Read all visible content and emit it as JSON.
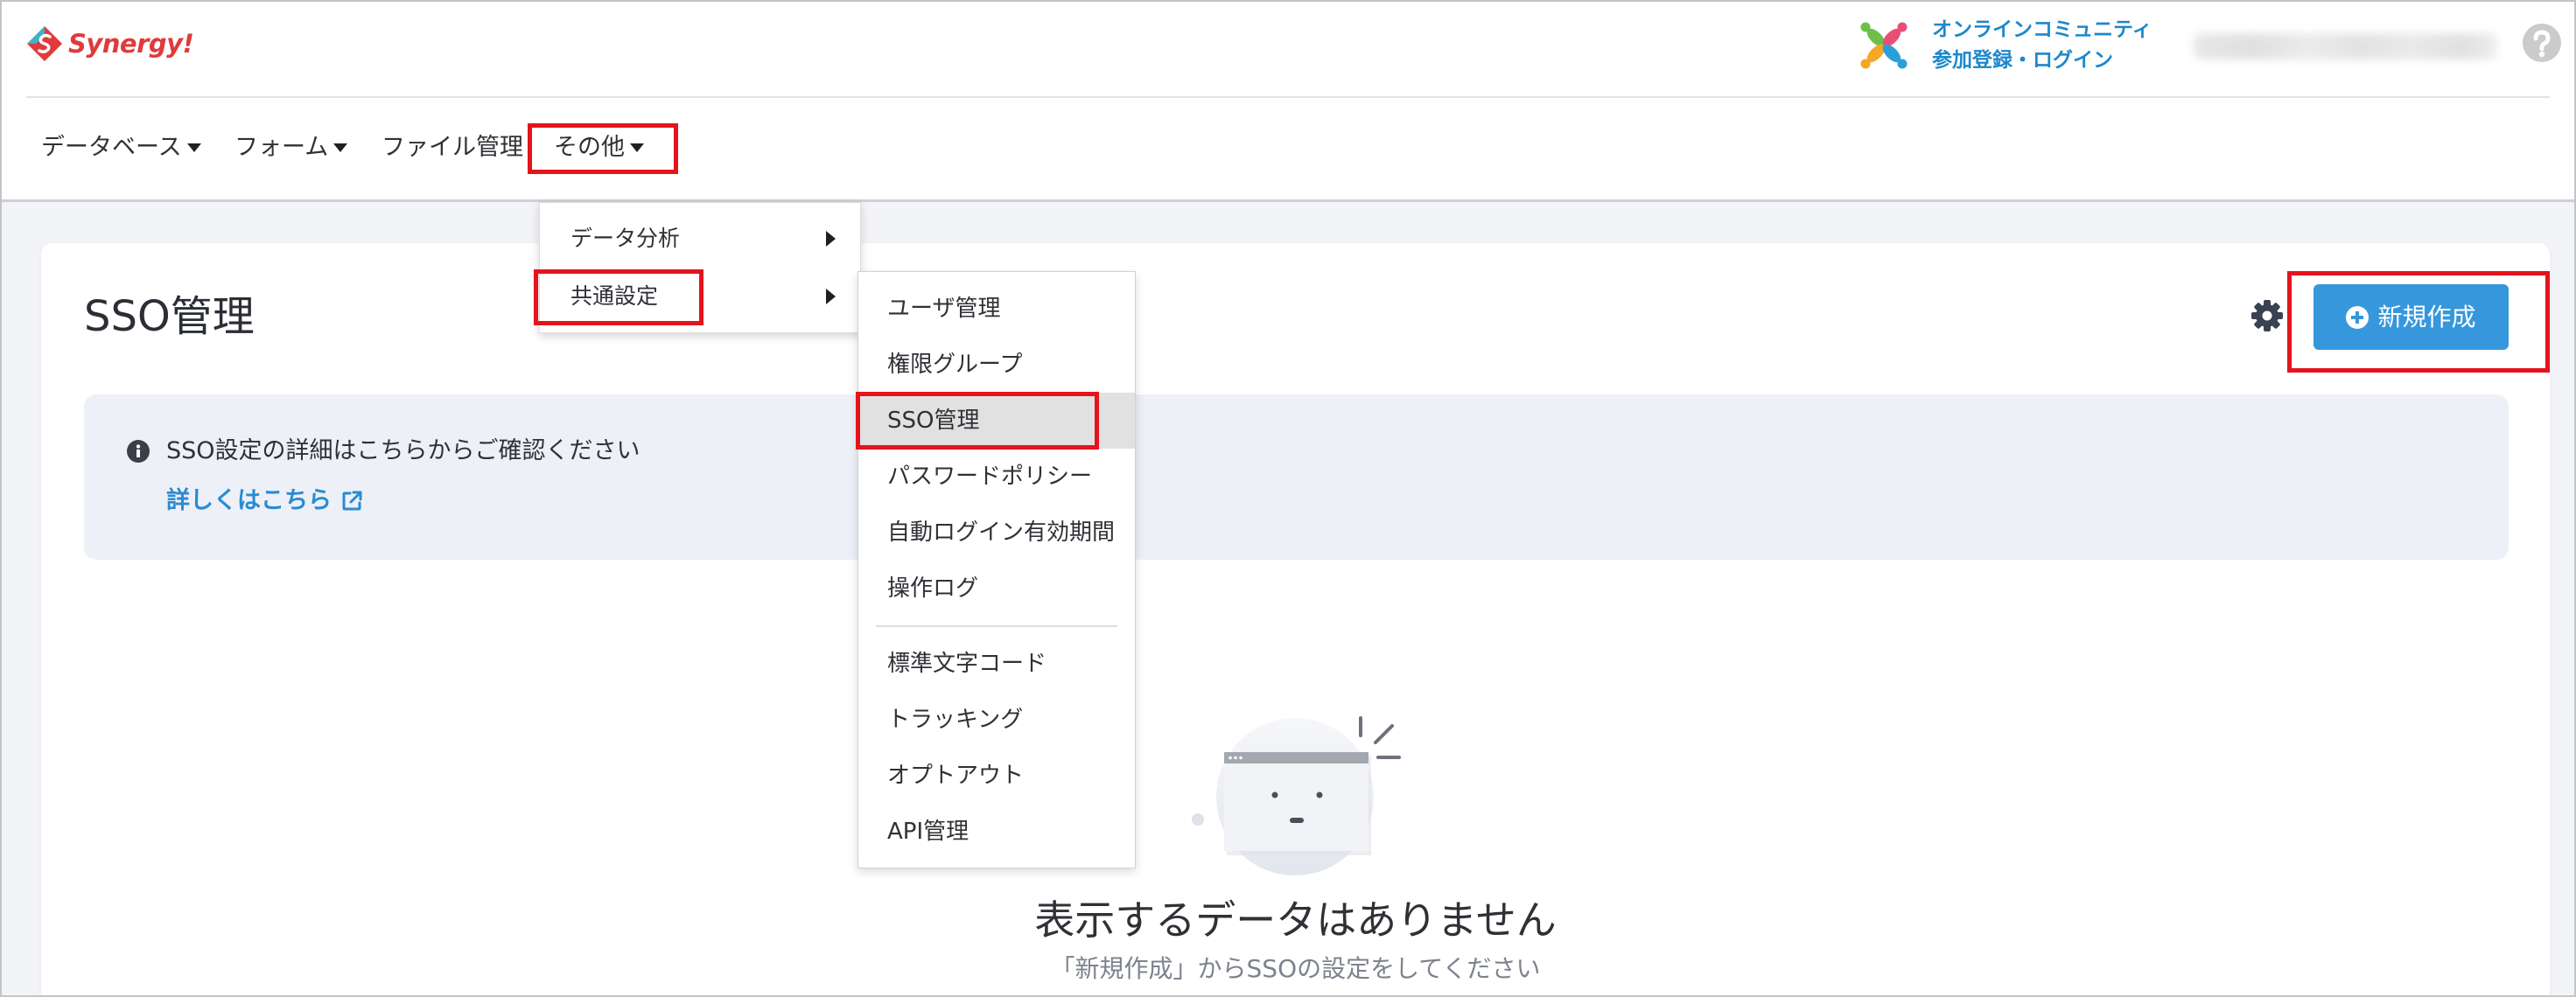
{
  "header": {
    "logo_text": "Synergy!",
    "logo_icon": "synergy-logo-icon",
    "community": {
      "icon": "community-pinwheel-icon",
      "title": "オンラインコミュニティ",
      "action": "参加登録・ログイン"
    },
    "help_icon": "help-icon"
  },
  "nav": {
    "items": [
      {
        "label": "データベース",
        "icon": "caret-down-icon"
      },
      {
        "label": "フォーム",
        "icon": "caret-down-icon"
      },
      {
        "label": "ファイル管理"
      },
      {
        "label": "その他",
        "icon": "caret-down-icon"
      }
    ]
  },
  "dropdown": {
    "items": [
      {
        "label": "データ分析",
        "icon": "caret-right-icon"
      },
      {
        "label": "共通設定",
        "icon": "caret-right-icon"
      }
    ]
  },
  "submenu": {
    "groups": [
      {
        "items": [
          {
            "label": "ユーザ管理"
          },
          {
            "label": "権限グループ"
          },
          {
            "label": "SSO管理",
            "selected": true
          },
          {
            "label": "パスワードポリシー"
          },
          {
            "label": "自動ログイン有効期間"
          },
          {
            "label": "操作ログ"
          }
        ]
      },
      {
        "items": [
          {
            "label": "標準文字コード"
          },
          {
            "label": "トラッキング"
          },
          {
            "label": "オプトアウト"
          },
          {
            "label": "API管理"
          }
        ]
      }
    ]
  },
  "page": {
    "title": "SSO管理",
    "settings_icon": "gear-icon",
    "create_button": {
      "label": "新規作成",
      "icon": "plus-circle-icon"
    },
    "info": {
      "icon": "info-circle-icon",
      "text": "SSO設定の詳細はこちらからご確認ください",
      "link_label": "詳しくはこちら",
      "link_icon": "external-link-icon"
    },
    "empty_state": {
      "illustration": "empty-browser-illustration",
      "title": "表示するデータはありません",
      "subtitle": "「新規作成」からSSOの設定をしてください"
    }
  },
  "colors": {
    "brand_red": "#e03a3c",
    "community_blue": "#1e87cc",
    "link_blue": "#2a8bd2",
    "button_blue": "#3797dc",
    "menu_selected_bg": "#e1e1e1",
    "info_box_bg": "#edf0f7",
    "page_bg": "#f3f4f8",
    "annotation_red": "#e4141d"
  }
}
